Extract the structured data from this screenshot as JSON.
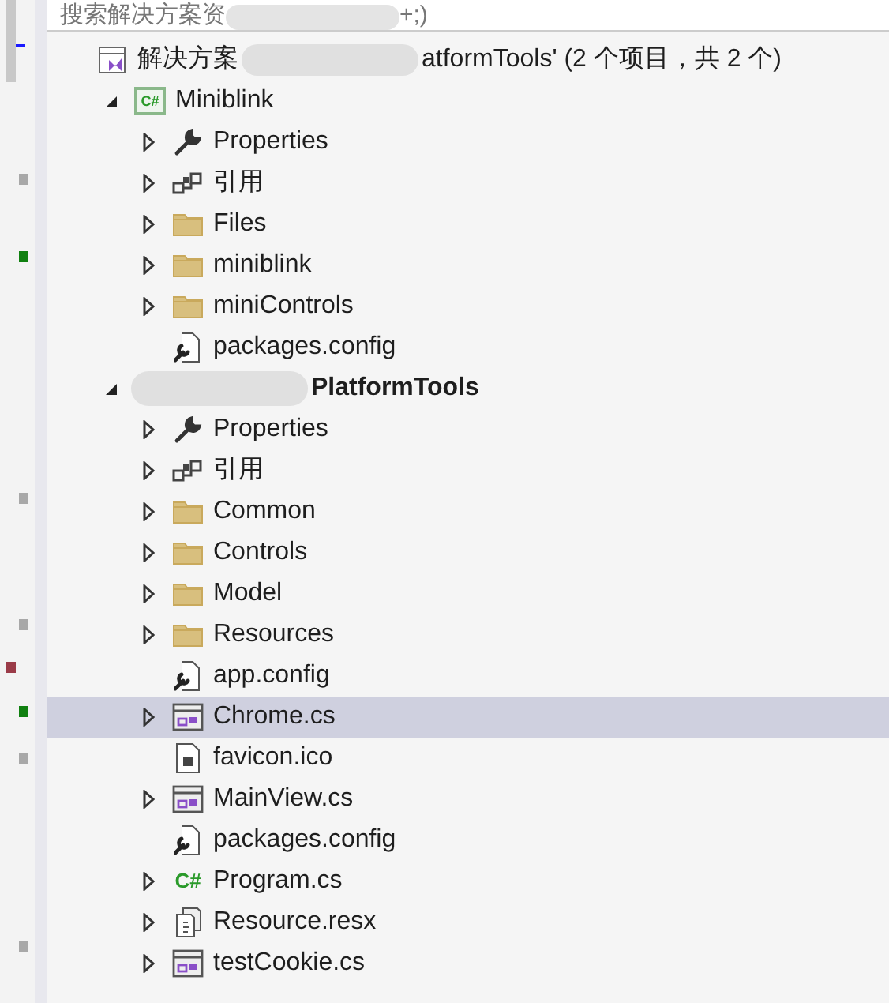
{
  "search": {
    "text": "搜索解决方案资",
    "text_end": "+;)"
  },
  "tree": [
    {
      "kind": "solution",
      "label": "解决方案",
      "label_end": "atformTools' (2 个项目，共 2 个)",
      "redacted": true,
      "selected": false,
      "children": [
        {
          "kind": "project",
          "badge": "C#",
          "label": "Miniblink",
          "startup": false,
          "expanded": true,
          "selected": false,
          "children": [
            {
              "kind": "properties",
              "label": "Properties",
              "expanded": false,
              "selected": false
            },
            {
              "kind": "references",
              "label": "引用",
              "expanded": false,
              "selected": false
            },
            {
              "kind": "folder",
              "label": "Files",
              "expanded": false,
              "selected": false
            },
            {
              "kind": "folder",
              "label": "miniblink",
              "expanded": false,
              "selected": false
            },
            {
              "kind": "folder",
              "label": "miniControls",
              "expanded": false,
              "selected": false
            },
            {
              "kind": "config",
              "label": "packages.config",
              "selected": false
            }
          ]
        },
        {
          "kind": "project",
          "label": "PlatformTools",
          "startup": true,
          "redacted": true,
          "expanded": true,
          "selected": false,
          "children": [
            {
              "kind": "properties",
              "label": "Properties",
              "expanded": false,
              "selected": false
            },
            {
              "kind": "references",
              "label": "引用",
              "expanded": false,
              "selected": false
            },
            {
              "kind": "folder",
              "label": "Common",
              "expanded": false,
              "selected": false
            },
            {
              "kind": "folder",
              "label": "Controls",
              "expanded": false,
              "selected": false
            },
            {
              "kind": "folder",
              "label": "Model",
              "expanded": false,
              "selected": false
            },
            {
              "kind": "folder",
              "label": "Resources",
              "expanded": false,
              "selected": false
            },
            {
              "kind": "config",
              "label": "app.config",
              "selected": false
            },
            {
              "kind": "form",
              "label": "Chrome.cs",
              "expanded": false,
              "selected": true
            },
            {
              "kind": "icon_file",
              "label": "favicon.ico",
              "selected": false
            },
            {
              "kind": "form",
              "label": "MainView.cs",
              "expanded": false,
              "selected": false
            },
            {
              "kind": "config",
              "label": "packages.config",
              "selected": false
            },
            {
              "kind": "csharp",
              "badge": "C#",
              "label": "Program.cs",
              "expanded": false,
              "selected": false
            },
            {
              "kind": "resx",
              "label": "Resource.resx",
              "expanded": false,
              "selected": false
            },
            {
              "kind": "form",
              "label": "testCookie.cs",
              "expanded": false,
              "selected": false
            }
          ]
        }
      ]
    }
  ]
}
